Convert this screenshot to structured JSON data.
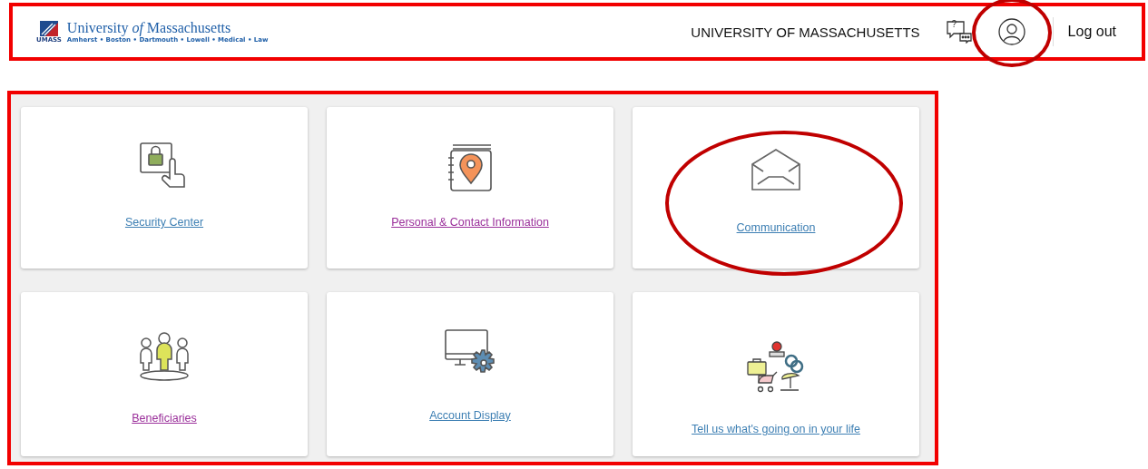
{
  "header": {
    "annotated": true,
    "logo": {
      "mark_text": "UMASS",
      "name": "University *of* Massachusetts",
      "campuses": "Amherst • Boston • Dartmouth • Lowell • Medical • Law"
    },
    "institution": "UNIVERSITY OF MASSACHUSETTS",
    "help_glyph": "?",
    "profile": {
      "annotated": true
    },
    "logout": "Log out"
  },
  "tiles_panel": {
    "annotated": true,
    "tiles": [
      {
        "kind": "security",
        "label": "Security Center",
        "visited": false,
        "annotated": false
      },
      {
        "kind": "contact",
        "label": "Personal & Contact Information",
        "visited": true,
        "annotated": false
      },
      {
        "kind": "communication",
        "label": "Communication",
        "visited": false,
        "annotated": true
      },
      {
        "kind": "beneficiaries",
        "label": "Beneficiaries",
        "visited": true,
        "annotated": false
      },
      {
        "kind": "display",
        "label": "Account Display",
        "visited": false,
        "annotated": false
      },
      {
        "kind": "life",
        "label": "Tell us what's going on in your life",
        "visited": false,
        "annotated": false
      }
    ]
  }
}
